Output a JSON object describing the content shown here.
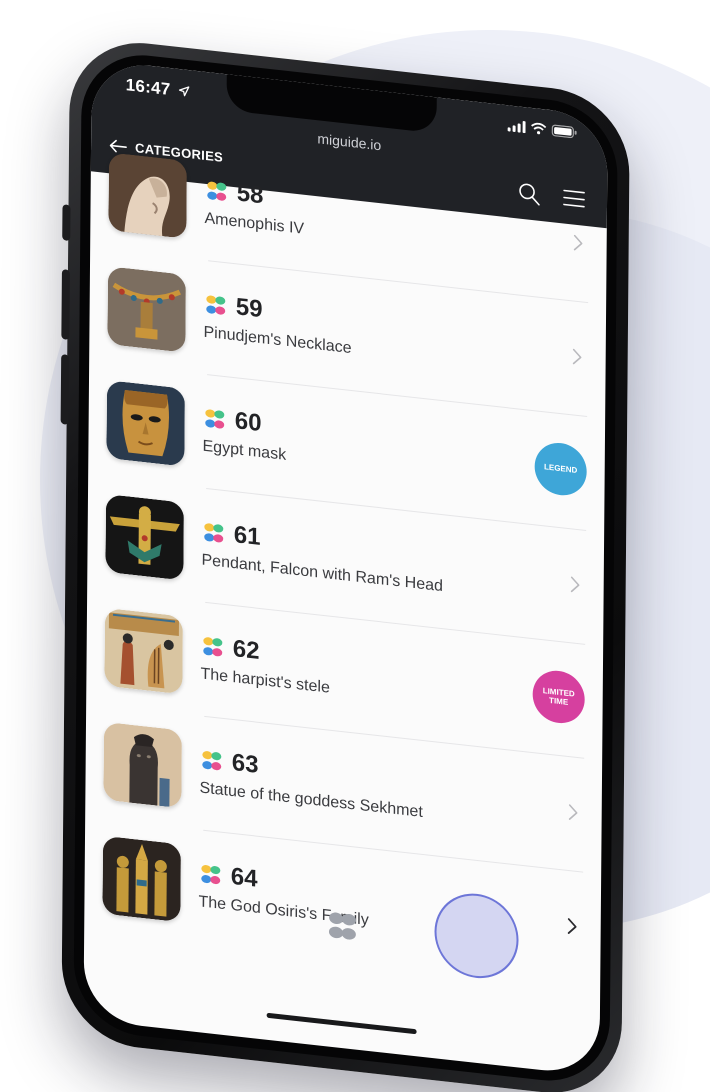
{
  "status_bar": {
    "time": "16:47",
    "location_arrow": "location-arrow-icon",
    "signal": "signal-icon",
    "wifi": "wifi-icon",
    "battery": "battery-icon"
  },
  "browser": {
    "url": "miguide.io"
  },
  "header": {
    "back_label": "CATEGORIES",
    "search_icon": "search-icon",
    "menu_icon": "hamburger-menu-icon"
  },
  "items": [
    {
      "number": "58",
      "title": "Amenophis IV",
      "badge": null
    },
    {
      "number": "59",
      "title": "Pinudjem's Necklace",
      "badge": null
    },
    {
      "number": "60",
      "title": "Egypt mask",
      "badge": "LEGEND"
    },
    {
      "number": "61",
      "title": "Pendant, Falcon with Ram's Head",
      "badge": null
    },
    {
      "number": "62",
      "title": "The harpist's stele",
      "badge": "LIMITED TIME"
    },
    {
      "number": "63",
      "title": "Statue of the goddess Sekhmet",
      "badge": null
    },
    {
      "number": "64",
      "title": "The God Osiris's Family",
      "badge": null
    }
  ],
  "colors": {
    "header_bg": "#202226",
    "legend_badge": "#3ea6d8",
    "limited_badge": "#d6409f",
    "logo_yellow": "#f6c23e",
    "logo_green": "#45c38a",
    "logo_blue": "#3d8fe0",
    "logo_pink": "#e8508f"
  }
}
